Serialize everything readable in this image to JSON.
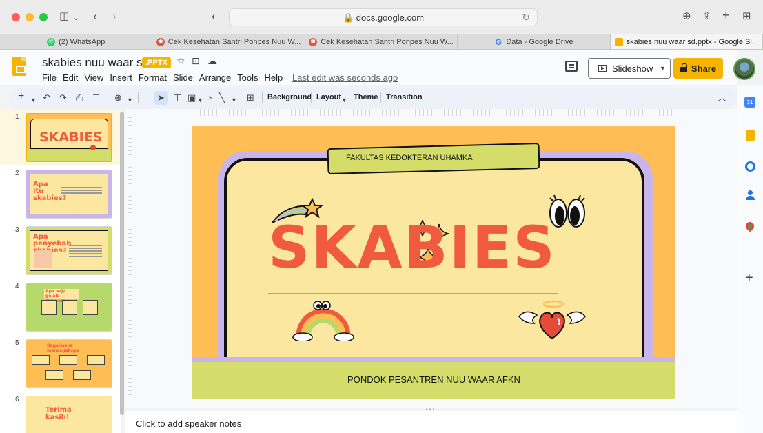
{
  "browser": {
    "url": "docs.google.com",
    "tabs": [
      {
        "label": "(2) WhatsApp",
        "favicon_color": "#25d366",
        "active": false
      },
      {
        "label": "Cek Kesehatan Santri Ponpes Nuu W...",
        "favicon_color": "#e8553e",
        "active": false
      },
      {
        "label": "Cek Kesehatan Santri Ponpes Nuu W...",
        "favicon_color": "#e8553e",
        "active": false
      },
      {
        "label": "Data - Google Drive",
        "favicon_color": "#4285f4",
        "active": false
      },
      {
        "label": "skabies nuu waar sd.pptx - Google Sl...",
        "favicon_color": "#f4b400",
        "active": true
      }
    ]
  },
  "doc": {
    "title": "skabies nuu waar sd",
    "badge": ".PPTX",
    "last_edit": "Last edit was seconds ago"
  },
  "menu": [
    "File",
    "Edit",
    "View",
    "Insert",
    "Format",
    "Slide",
    "Arrange",
    "Tools",
    "Help"
  ],
  "header_buttons": {
    "slideshow": "Slideshow",
    "share": "Share"
  },
  "toolbar": {
    "background": "Background",
    "layout": "Layout",
    "theme": "Theme",
    "transition": "Transition"
  },
  "slides": [
    {
      "number": "1",
      "title": "SKABIES",
      "selected": true
    },
    {
      "number": "2",
      "title": "Apa itu skabies?",
      "selected": false
    },
    {
      "number": "3",
      "title": "Apa penyebab skabies?",
      "selected": false
    },
    {
      "number": "4",
      "title": "Apa aaja gejala skabies?",
      "selected": false
    },
    {
      "number": "5",
      "title": "Bagaimana mencegahnya",
      "selected": false
    },
    {
      "number": "6",
      "title": "Terima kasih!",
      "selected": false
    }
  ],
  "main_slide": {
    "header": "FAKULTAS KEDOKTERAN UHAMKA",
    "title": "SKABIES",
    "footer": "PONDOK PESANTREN NUU WAAR AFKN"
  },
  "speaker_notes": {
    "placeholder": "Click to add speaker notes"
  },
  "colors": {
    "accent": "#f4b400",
    "slide_orange": "#ffbe54",
    "slide_cream": "#fce7a0",
    "slide_green": "#d4dd6a",
    "slide_lavender": "#c8b5ea",
    "title_red": "#f05a3e"
  }
}
